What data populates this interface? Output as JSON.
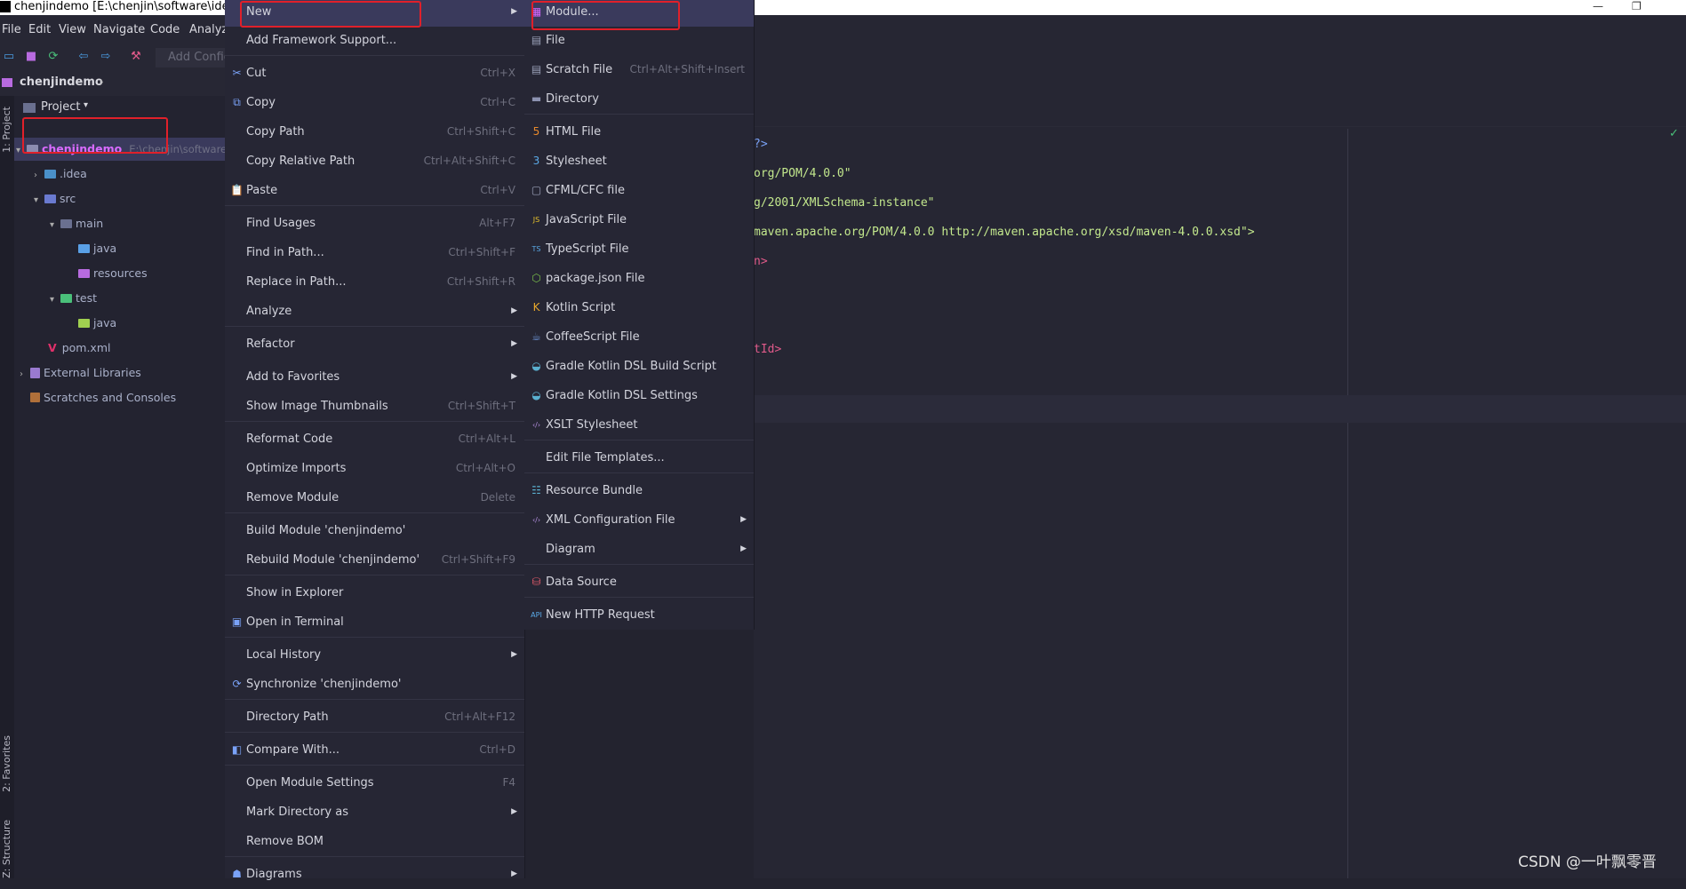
{
  "window": {
    "title": "chenjindemo [E:\\chenjin\\software\\ideaw",
    "minimize": "—",
    "maximize": "❐"
  },
  "menubar": [
    "File",
    "Edit",
    "View",
    "Navigate",
    "Code",
    "Analyze"
  ],
  "toolbar": {
    "add_config": "Add Config"
  },
  "breadcrumb": {
    "project": "chenjindemo"
  },
  "side_tabs": {
    "project": "1: Project",
    "favorites": "2: Favorites",
    "structure": "Z: Structure"
  },
  "project_panel": {
    "header": "Project",
    "tree": [
      {
        "label": "chenjindemo",
        "path": "E:\\chenjin\\software\\",
        "color": "#d96bff",
        "folder": "#8c8cb0"
      },
      {
        "label": ".idea",
        "color": "#a9b0c9",
        "folder": "#4a90c9"
      },
      {
        "label": "src",
        "color": "#a9b0c9",
        "folder": "#6a7ad0"
      },
      {
        "label": "main",
        "color": "#a9b0c9",
        "folder": "#6a7090"
      },
      {
        "label": "java",
        "color": "#a9b0c9",
        "folder": "#5aa0e6"
      },
      {
        "label": "resources",
        "color": "#a9b0c9",
        "folder": "#b86be0"
      },
      {
        "label": "test",
        "color": "#a9b0c9",
        "folder": "#4ac07a"
      },
      {
        "label": "java",
        "color": "#a9b0c9",
        "folder": "#a0d050"
      },
      {
        "label": "pom.xml",
        "color": "#a9b0c9",
        "folder": ""
      },
      {
        "label": "External Libraries",
        "color": "#a9b0c9",
        "folder": ""
      },
      {
        "label": "Scratches and Consoles",
        "color": "#a9b0c9",
        "folder": ""
      }
    ]
  },
  "context_menu": [
    {
      "label": "New",
      "shortcut": "",
      "sub": true,
      "icon": ""
    },
    {
      "label": "Add Framework Support...",
      "shortcut": "",
      "sub": false,
      "icon": ""
    },
    {
      "label": "Cut",
      "shortcut": "Ctrl+X",
      "sub": false,
      "icon": "✂"
    },
    {
      "label": "Copy",
      "shortcut": "Ctrl+C",
      "sub": false,
      "icon": "⧉"
    },
    {
      "label": "Copy Path",
      "shortcut": "Ctrl+Shift+C",
      "sub": false,
      "icon": ""
    },
    {
      "label": "Copy Relative Path",
      "shortcut": "Ctrl+Alt+Shift+C",
      "sub": false,
      "icon": ""
    },
    {
      "label": "Paste",
      "shortcut": "Ctrl+V",
      "sub": false,
      "icon": "📋"
    },
    {
      "label": "Find Usages",
      "shortcut": "Alt+F7",
      "sub": false,
      "icon": ""
    },
    {
      "label": "Find in Path...",
      "shortcut": "Ctrl+Shift+F",
      "sub": false,
      "icon": ""
    },
    {
      "label": "Replace in Path...",
      "shortcut": "Ctrl+Shift+R",
      "sub": false,
      "icon": ""
    },
    {
      "label": "Analyze",
      "shortcut": "",
      "sub": true,
      "icon": ""
    },
    {
      "label": "Refactor",
      "shortcut": "",
      "sub": true,
      "icon": ""
    },
    {
      "label": "Add to Favorites",
      "shortcut": "",
      "sub": true,
      "icon": ""
    },
    {
      "label": "Show Image Thumbnails",
      "shortcut": "Ctrl+Shift+T",
      "sub": false,
      "icon": ""
    },
    {
      "label": "Reformat Code",
      "shortcut": "Ctrl+Alt+L",
      "sub": false,
      "icon": ""
    },
    {
      "label": "Optimize Imports",
      "shortcut": "Ctrl+Alt+O",
      "sub": false,
      "icon": ""
    },
    {
      "label": "Remove Module",
      "shortcut": "Delete",
      "sub": false,
      "icon": ""
    },
    {
      "label": "Build Module 'chenjindemo'",
      "shortcut": "",
      "sub": false,
      "icon": ""
    },
    {
      "label": "Rebuild Module 'chenjindemo'",
      "shortcut": "Ctrl+Shift+F9",
      "sub": false,
      "icon": ""
    },
    {
      "label": "Show in Explorer",
      "shortcut": "",
      "sub": false,
      "icon": ""
    },
    {
      "label": "Open in Terminal",
      "shortcut": "",
      "sub": false,
      "icon": "▣"
    },
    {
      "label": "Local History",
      "shortcut": "",
      "sub": true,
      "icon": ""
    },
    {
      "label": "Synchronize 'chenjindemo'",
      "shortcut": "",
      "sub": false,
      "icon": "⟳"
    },
    {
      "label": "Directory Path",
      "shortcut": "Ctrl+Alt+F12",
      "sub": false,
      "icon": ""
    },
    {
      "label": "Compare With...",
      "shortcut": "Ctrl+D",
      "sub": false,
      "icon": "◧"
    },
    {
      "label": "Open Module Settings",
      "shortcut": "F4",
      "sub": false,
      "icon": ""
    },
    {
      "label": "Mark Directory as",
      "shortcut": "",
      "sub": true,
      "icon": ""
    },
    {
      "label": "Remove BOM",
      "shortcut": "",
      "sub": false,
      "icon": ""
    },
    {
      "label": "Diagrams",
      "shortcut": "",
      "sub": true,
      "icon": "☗"
    }
  ],
  "new_submenu": [
    {
      "label": "Module...",
      "shortcut": "",
      "sub": false,
      "icon": "▦",
      "color": "#d966ff"
    },
    {
      "label": "File",
      "shortcut": "",
      "sub": false,
      "icon": "▤",
      "color": "#9aa0b8"
    },
    {
      "label": "Scratch File",
      "shortcut": "Ctrl+Alt+Shift+Insert",
      "sub": false,
      "icon": "▤",
      "color": "#9aa0b8"
    },
    {
      "label": "Directory",
      "shortcut": "",
      "sub": false,
      "icon": "▬",
      "color": "#8c92b0"
    },
    {
      "label": "HTML File",
      "shortcut": "",
      "sub": false,
      "icon": "5",
      "color": "#e8892b"
    },
    {
      "label": "Stylesheet",
      "shortcut": "",
      "sub": false,
      "icon": "3",
      "color": "#5aa9e6"
    },
    {
      "label": "CFML/CFC file",
      "shortcut": "",
      "sub": false,
      "icon": "▢",
      "color": "#9aa0b8"
    },
    {
      "label": "JavaScript File",
      "shortcut": "",
      "sub": false,
      "icon": "JS",
      "color": "#e8c32b"
    },
    {
      "label": "TypeScript File",
      "shortcut": "",
      "sub": false,
      "icon": "TS",
      "color": "#5aa9e6"
    },
    {
      "label": "package.json File",
      "shortcut": "",
      "sub": false,
      "icon": "⬡",
      "color": "#7bc04a"
    },
    {
      "label": "Kotlin Script",
      "shortcut": "",
      "sub": false,
      "icon": "K",
      "color": "#e8a82b"
    },
    {
      "label": "CoffeeScript File",
      "shortcut": "",
      "sub": false,
      "icon": "☕",
      "color": "#6a8fd0"
    },
    {
      "label": "Gradle Kotlin DSL Build Script",
      "shortcut": "",
      "sub": false,
      "icon": "◒",
      "color": "#5ab0d0"
    },
    {
      "label": "Gradle Kotlin DSL Settings",
      "shortcut": "",
      "sub": false,
      "icon": "◒",
      "color": "#5ab0d0"
    },
    {
      "label": "XSLT Stylesheet",
      "shortcut": "",
      "sub": false,
      "icon": "‹/›",
      "color": "#b48ee0"
    },
    {
      "label": "Edit File Templates...",
      "shortcut": "",
      "sub": false,
      "icon": "",
      "color": ""
    },
    {
      "label": "Resource Bundle",
      "shortcut": "",
      "sub": false,
      "icon": "☷",
      "color": "#5ab0d0"
    },
    {
      "label": "XML Configuration File",
      "shortcut": "",
      "sub": true,
      "icon": "‹/›",
      "color": "#b48ee0"
    },
    {
      "label": "Diagram",
      "shortcut": "",
      "sub": true,
      "icon": "",
      "color": ""
    },
    {
      "label": "Data Source",
      "shortcut": "",
      "sub": false,
      "icon": "⛁",
      "color": "#e05a6a"
    },
    {
      "label": "New HTTP Request",
      "shortcut": "",
      "sub": false,
      "icon": "API",
      "color": "#5aa9e6"
    }
  ],
  "editor": {
    "lines": [
      "?>",
      "org/POM/4.0.0\"",
      "g/2001/XMLSchema-instance\"",
      "maven.apache.org/POM/4.0.0 http://maven.apache.org/xsd/maven-4.0.0.xsd\">",
      "n>",
      "tId>"
    ],
    "check": "✓"
  },
  "watermark": "CSDN @一叶飘零晋",
  "colors": {
    "highlight_red": "#e0202a",
    "code_green": "#c3e88d",
    "tag_blue": "#7aa2f7"
  }
}
